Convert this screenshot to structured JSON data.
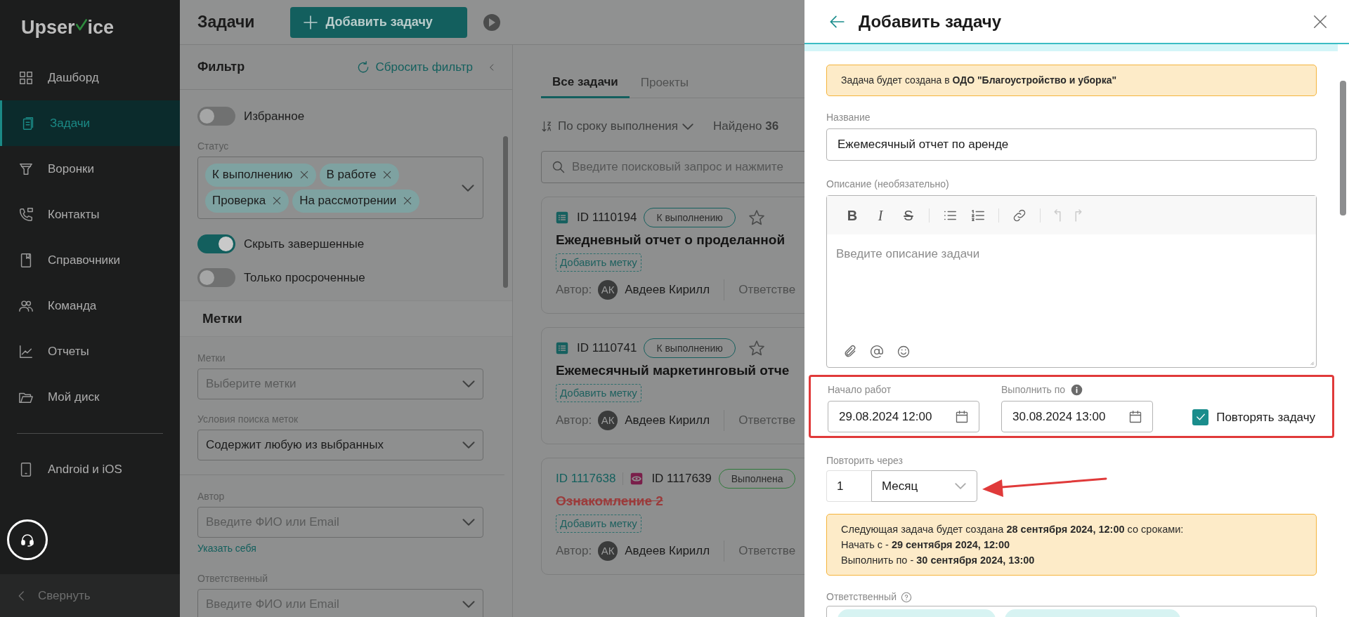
{
  "sidebar": {
    "logo": [
      "Upser",
      "ice"
    ],
    "items": [
      {
        "label": "Дашборд",
        "selected": false
      },
      {
        "label": "Задачи",
        "selected": true
      },
      {
        "label": "Воронки",
        "selected": false
      },
      {
        "label": "Контакты",
        "selected": false
      },
      {
        "label": "Справочники",
        "selected": false
      },
      {
        "label": "Команда",
        "selected": false
      },
      {
        "label": "Отчеты",
        "selected": false
      },
      {
        "label": "Мой диск",
        "selected": false
      }
    ],
    "extra_items": [
      {
        "label": "Android и iOS",
        "selected": false
      }
    ],
    "collapse": "Свернуть"
  },
  "header": {
    "title": "Задачи",
    "add_button": "Добавить задачу"
  },
  "filter": {
    "title": "Фильтр",
    "reset": "Сбросить фильтр",
    "items": [
      {
        "kind": "toggle",
        "label": "Избранное",
        "on": false
      },
      {
        "kind": "chips",
        "label": "Статус",
        "chips": [
          "К выполнению",
          "В работе",
          "Проверка",
          "На рассмотрении"
        ]
      },
      {
        "kind": "toggle",
        "label": "Скрыть завершенные",
        "on": true
      },
      {
        "kind": "toggle",
        "label": "Только просроченные",
        "on": false
      },
      {
        "kind": "section",
        "label": "Метки"
      },
      {
        "kind": "select",
        "label": "Метки",
        "placeholder": "Выберите метки"
      },
      {
        "kind": "select",
        "label": "Условия поиска меток",
        "value": "Содержит любую из выбранных"
      },
      {
        "kind": "divider"
      },
      {
        "kind": "select",
        "label": "Автор",
        "placeholder": "Введите ФИО или Email"
      },
      {
        "kind": "link",
        "label": "Указать себя"
      },
      {
        "kind": "select",
        "label": "Ответственный",
        "placeholder": "Введите ФИО или Email"
      }
    ]
  },
  "tasks": {
    "tabs": [
      {
        "label": "Все задачи",
        "selected": true
      },
      {
        "label": "Проекты",
        "selected": false
      }
    ],
    "sort": "По сроку выполнения",
    "found": "Найдено **36**",
    "search_placeholder": "Введите поисковый запрос и нажмите",
    "cards": [
      {
        "ids": [
          {
            "text": "ID 1110194",
            "kind": "list"
          }
        ],
        "status": "К выполнению",
        "starred": false,
        "title": "Ежедневный отчет о проделанной",
        "done": false,
        "tag_button": "Добавить метку",
        "author_label": "Автор:",
        "avatar": "АК",
        "author": "Авдеев Кирилл",
        "responsible_label": "Ответстве"
      },
      {
        "ids": [
          {
            "text": "ID 1110741",
            "kind": "list"
          }
        ],
        "status": "К выполнению",
        "starred": false,
        "title": "Ежемесячный маркетинговый отче",
        "done": false,
        "tag_button": "Добавить метку",
        "author_label": "Автор:",
        "avatar": "АК",
        "author": "Авдеев Кирилл",
        "responsible_label": "Ответстве"
      },
      {
        "ids": [
          {
            "text": "ID 1117638",
            "kind": "link"
          },
          {
            "text": "ID 1117639",
            "kind": "eye"
          }
        ],
        "status": "Выполнена",
        "title": "Ознакомление 2",
        "done": true,
        "tag_button": "Добавить метку",
        "author_label": "Автор:",
        "avatar": "АК",
        "author": "Авдеев Кирилл",
        "responsible_label": "Ответстве"
      }
    ]
  },
  "drawer": {
    "title": "Добавить задачу",
    "notice": "Задача будет создана в **ОДО \"Благоустройство и уборка\"**",
    "name": {
      "label": "Название",
      "value": "Ежемесячный отчет по аренде"
    },
    "description": {
      "label": "Описание (необязательно)",
      "placeholder": "Введите описание задачи",
      "format_buttons": [
        {
          "glyph": "B",
          "kind": "bold"
        },
        {
          "glyph": "I",
          "kind": "italic"
        },
        {
          "glyph": "S",
          "kind": "strike"
        }
      ]
    },
    "start": {
      "label": "Начало работ",
      "value": "29.08.2024 12:00"
    },
    "due": {
      "label": "Выполнить по",
      "value": "30.08.2024 13:00"
    },
    "repeat": {
      "label": "Повторять задачу",
      "checked": true
    },
    "repeat_every": {
      "label": "Повторить через",
      "count": "1",
      "unit": "Месяц"
    },
    "schedule": [
      "Следующая задача будет создана **28 сентября 2024, 12:00** со сроками:",
      "Начать с - **29 сентября 2024, 12:00**",
      "Выполнить по - **30 сентября 2024, 13:00**"
    ],
    "responsible": {
      "label": "Ответственный"
    }
  }
}
